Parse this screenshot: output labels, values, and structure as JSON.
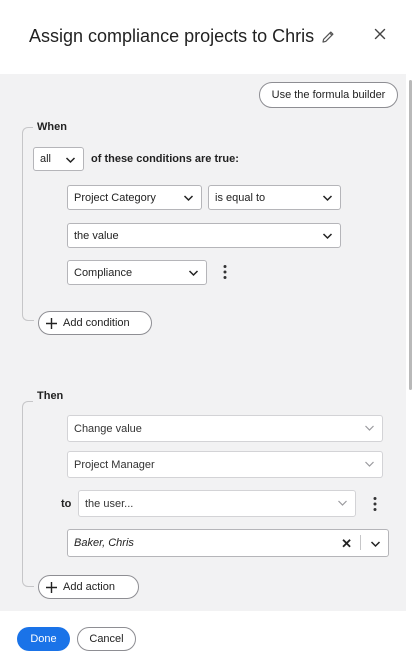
{
  "header": {
    "title": "Assign compliance projects to Chris",
    "edit_icon": "pencil-icon",
    "close_icon": "close-icon"
  },
  "toolbar": {
    "formula_builder_label": "Use the formula builder"
  },
  "when": {
    "label": "When",
    "match_select": "all",
    "match_text": "of these conditions are true:",
    "condition": {
      "field": "Project Category",
      "operator": "is equal to",
      "value_type": "the value",
      "value": "Compliance"
    },
    "add_condition_label": "Add condition"
  },
  "then": {
    "label": "Then",
    "action": "Change value",
    "field": "Project Manager",
    "to_label": "to",
    "to_select": "the user...",
    "user_value": "Baker, Chris",
    "add_action_label": "Add action"
  },
  "footer": {
    "done_label": "Done",
    "cancel_label": "Cancel"
  },
  "colors": {
    "primary": "#1a73e8",
    "panel_bg": "#f2f2f3"
  }
}
